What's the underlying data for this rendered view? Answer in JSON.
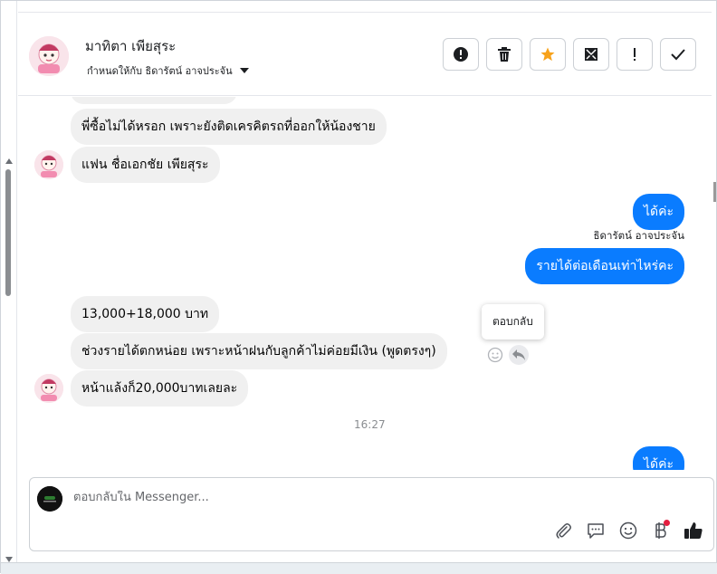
{
  "header": {
    "contact_name": "มาทิตา เพียสุระ",
    "assigned_to": "กำหนดให้กับ ธิดารัตน์ อาจประจัน",
    "actions": [
      {
        "name": "report-spam-button",
        "icon": "exclamation-circle-icon"
      },
      {
        "name": "delete-button",
        "icon": "trash-icon"
      },
      {
        "name": "star-button",
        "icon": "star-icon"
      },
      {
        "name": "mark-unread-button",
        "icon": "envelope-icon"
      },
      {
        "name": "follow-up-button",
        "icon": "exclamation-icon"
      },
      {
        "name": "mark-done-button",
        "icon": "check-icon"
      }
    ]
  },
  "messages": {
    "m1": "พี่ซื้อไม่ได้หรอก  เพราะยังติดเครคิตรถที่ออกให้น้องชาย",
    "m2": "แฟน ชื่อเอกชัย  เพียสุระ",
    "m3": "ได้ค่ะ",
    "m3_sender": "ธิดารัตน์ อาจประจัน",
    "m4": "รายได้ต่อเดือนเท่าไหร่คะ",
    "m5": "13,000+18,000 บาท",
    "m6": "ช่วงรายได้ตกหน่อย เพราะหน้าฝนกับลูกค้าไม่ค่อยมีเงิน  (พูดตรงๆ)",
    "m7": "หน้าแล้งก็20,000บาทเลยละ",
    "time": "16:27",
    "m8": "ได้ค่ะ"
  },
  "tooltip": "ตอบกลับ",
  "composer": {
    "placeholder": "ตอบกลับใน Messenger..."
  },
  "tools": [
    "paperclip-icon",
    "saved-reply-icon",
    "emoji-icon",
    "payment-icon",
    "like-icon"
  ],
  "colors": {
    "outgoing_bubble": "#0a7cff",
    "incoming_bubble": "#f0f0f0",
    "star": "#f7a21b",
    "notification_dot": "#e41e3f"
  }
}
